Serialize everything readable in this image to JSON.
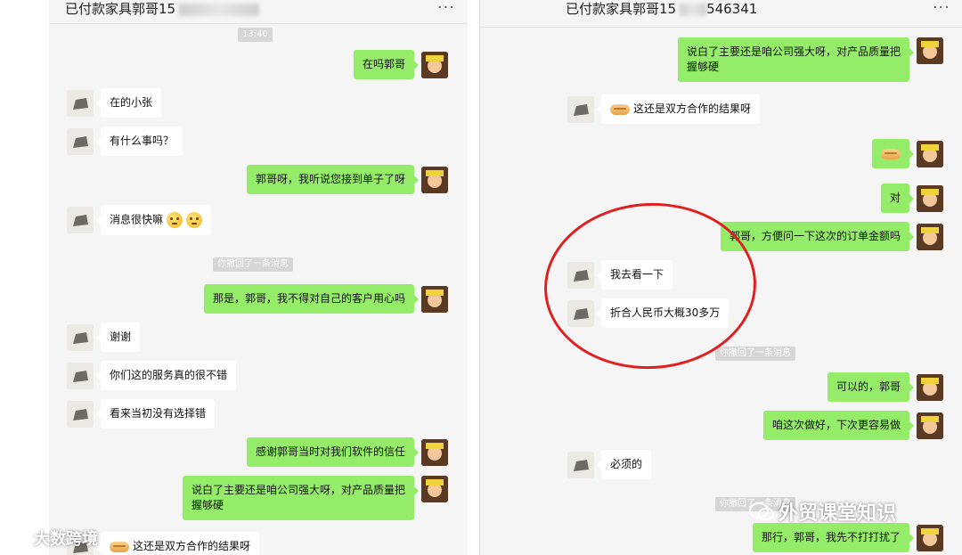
{
  "left": {
    "title": "已付款家具郭哥15",
    "more": "···",
    "time": "13:40",
    "messages": [
      {
        "side": "sent",
        "text": "在吗郭哥"
      },
      {
        "side": "recv",
        "text": "在的小张"
      },
      {
        "side": "recv",
        "text": "有什么事吗？"
      },
      {
        "side": "sent",
        "text": "郭哥呀，我听说您接到单子了呀"
      },
      {
        "side": "recv",
        "text": "消息很快嘛"
      },
      {
        "side": "sent",
        "text": "那是，郭哥，我不得对自己的客户用心吗"
      },
      {
        "side": "recv",
        "text": "谢谢"
      },
      {
        "side": "recv",
        "text": "你们这的服务真的很不错"
      },
      {
        "side": "recv",
        "text": "看来当初没有选择错"
      },
      {
        "side": "sent",
        "text": "感谢郭哥当时对我们软件的信任"
      },
      {
        "side": "sent",
        "text": "说白了主要还是咱公司强大呀，对产品质量把握够硬"
      },
      {
        "side": "recv",
        "text": "这还是双方合作的结果呀"
      }
    ],
    "system_note": "你撤回了一条消息"
  },
  "right": {
    "title": "已付款家具郭哥15",
    "title_tail": "546341",
    "more": "···",
    "messages": [
      {
        "side": "sent",
        "text": "说白了主要还是咱公司强大呀，对产品质量把握够硬"
      },
      {
        "side": "recv",
        "text": "这还是双方合作的结果呀"
      },
      {
        "side": "sent",
        "text": ""
      },
      {
        "side": "sent",
        "text": "对"
      },
      {
        "side": "sent",
        "text": "郭哥，方便问一下这次的订单金额吗"
      },
      {
        "side": "recv",
        "text": "我去看一下"
      },
      {
        "side": "recv",
        "text": "折合人民币大概30多万"
      },
      {
        "side": "sent",
        "text": "可以的，郭哥"
      },
      {
        "side": "sent",
        "text": "咱这次做好，下次更容易做"
      },
      {
        "side": "recv",
        "text": "必须的"
      },
      {
        "side": "sent",
        "text": "那行，郭哥，我先不打打扰了"
      }
    ],
    "system_note": "你撤回了一条消息",
    "system_note_2": "你撤回了一条消息"
  },
  "watermarks": {
    "left": "大数跨境",
    "right": "外贸课堂知识"
  },
  "colors": {
    "sent_bubble": "#95ec69",
    "recv_bubble": "#ffffff",
    "highlight_circle": "#e02020"
  }
}
